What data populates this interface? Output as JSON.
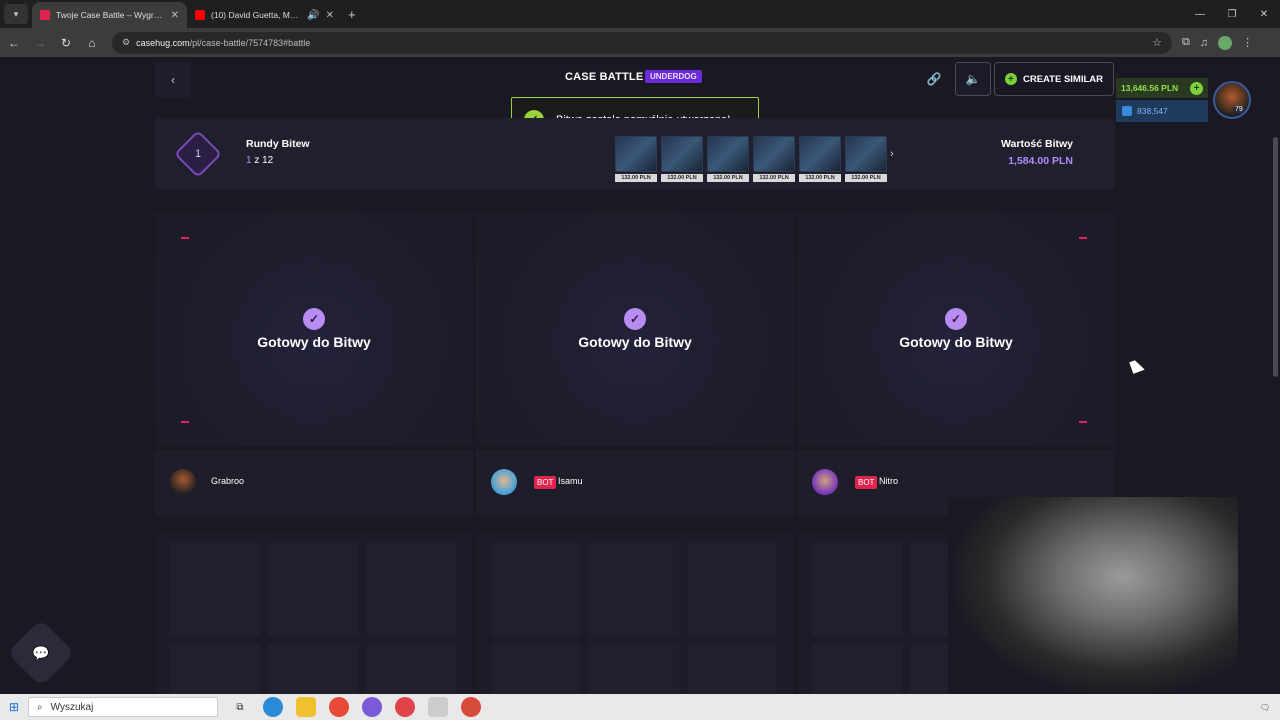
{
  "browser": {
    "tabs": [
      {
        "title": "Twoje Case Battle – Wygrywaj s",
        "active": true,
        "favicon_color": "#e0244e"
      },
      {
        "title": "(10) David Guetta, MEDUZA",
        "active": false,
        "favicon_color": "#ff0000"
      }
    ],
    "url_domain": "casehug.com",
    "url_path": "/pl/case-battle/7574783#battle"
  },
  "header": {
    "title": "CASE BATTLE",
    "mode_badge": "UNDERDOG",
    "create_similar": "CREATE SIMILAR"
  },
  "wallet": {
    "balance": "13,646.56 PLN",
    "gems": "838,547"
  },
  "user": {
    "level": "79"
  },
  "toast": {
    "message": "Bitwa została pomyślnie utworzona!"
  },
  "rounds": {
    "current": "1",
    "label": "Rundy Bitew",
    "count_current": "1",
    "count_text": " z 12",
    "cases": [
      {
        "price": "132.00 PLN"
      },
      {
        "price": "132.00 PLN"
      },
      {
        "price": "132.00 PLN"
      },
      {
        "price": "132.00 PLN"
      },
      {
        "price": "132.00 PLN"
      },
      {
        "price": "132.00 PLN"
      }
    ],
    "value_label": "Wartość Bitwy",
    "value_amount": "1,584.00 PLN"
  },
  "slots": [
    {
      "status": "Gotowy do Bitwy"
    },
    {
      "status": "Gotowy do Bitwy"
    },
    {
      "status": "Gotowy do Bitwy"
    }
  ],
  "players": [
    {
      "name": "Grabroo",
      "bot": false
    },
    {
      "name": "Isamu",
      "bot": true,
      "bot_label": "BOT"
    },
    {
      "name": "Nitro",
      "bot": true,
      "bot_label": "BOT"
    }
  ],
  "taskbar": {
    "search_placeholder": "Wyszukaj"
  },
  "colors": {
    "accent_purple": "#6a2bd9",
    "success_green": "#9bd13a",
    "bot_red": "#e0244e"
  }
}
